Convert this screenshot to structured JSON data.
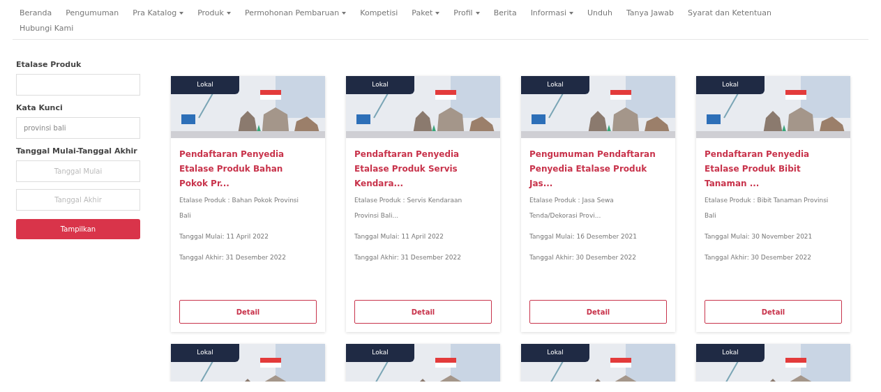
{
  "nav": {
    "items": [
      {
        "label": "Beranda",
        "dropdown": false
      },
      {
        "label": "Pengumuman",
        "dropdown": false
      },
      {
        "label": "Pra Katalog",
        "dropdown": true
      },
      {
        "label": "Produk",
        "dropdown": true
      },
      {
        "label": "Permohonan Pembaruan",
        "dropdown": true
      },
      {
        "label": "Kompetisi",
        "dropdown": false
      },
      {
        "label": "Paket",
        "dropdown": true
      },
      {
        "label": "Profil",
        "dropdown": true
      },
      {
        "label": "Berita",
        "dropdown": false
      },
      {
        "label": "Informasi",
        "dropdown": true
      },
      {
        "label": "Unduh",
        "dropdown": false
      },
      {
        "label": "Tanya Jawab",
        "dropdown": false
      },
      {
        "label": "Syarat dan Ketentuan",
        "dropdown": false
      },
      {
        "label": "Hubungi Kami",
        "dropdown": false
      }
    ]
  },
  "filters": {
    "fields": [
      {
        "label": "Etalase Produk",
        "inputs": [
          {
            "kind": "text"
          }
        ]
      },
      {
        "label": "Kata Kunci",
        "inputs": [
          {
            "kind": "text",
            "value": "provinsi bali"
          }
        ]
      },
      {
        "label": "Tanggal Mulai-Tanggal Akhir",
        "inputs": [
          {
            "kind": "date",
            "placeholder": "Tanggal Mulai"
          },
          {
            "kind": "date",
            "placeholder": "Tanggal Akhir"
          }
        ]
      }
    ],
    "button": "Tampilkan"
  },
  "cards": [
    {
      "badge": "Lokal",
      "title": "Pendaftaran Penyedia Etalase Produk Bahan Pokok Pr...",
      "description": "Etalase Produk : Bahan Pokok Provinsi Bali",
      "start": "Tanggal Mulai: 11 April 2022",
      "end": "Tanggal Akhir: 31 Desember 2022",
      "button": "Detail"
    },
    {
      "badge": "Lokal",
      "title": "Pendaftaran Penyedia Etalase Produk Servis Kendara...",
      "description": "Etalase Produk : Servis Kendaraan Provinsi Bali...",
      "start": "Tanggal Mulai: 11 April 2022",
      "end": "Tanggal Akhir: 31 Desember 2022",
      "button": "Detail"
    },
    {
      "badge": "Lokal",
      "title": "Pengumuman Pendaftaran Penyedia Etalase Produk Jas...",
      "description": "Etalase Produk : Jasa Sewa Tenda/Dekorasi Provi...",
      "start": "Tanggal Mulai: 16 Desember 2021",
      "end": "Tanggal Akhir: 30 Desember 2022",
      "button": "Detail"
    },
    {
      "badge": "Lokal",
      "title": "Pendaftaran Penyedia Etalase Produk Bibit Tanaman ...",
      "description": "Etalase Produk : Bibit Tanaman Provinsi Bali",
      "start": "Tanggal Mulai: 30 November 2021",
      "end": "Tanggal Akhir: 30 Desember 2022",
      "button": "Detail"
    },
    {
      "badge": "Lokal"
    },
    {
      "badge": "Lokal"
    },
    {
      "badge": "Lokal"
    },
    {
      "badge": "Lokal"
    }
  ]
}
